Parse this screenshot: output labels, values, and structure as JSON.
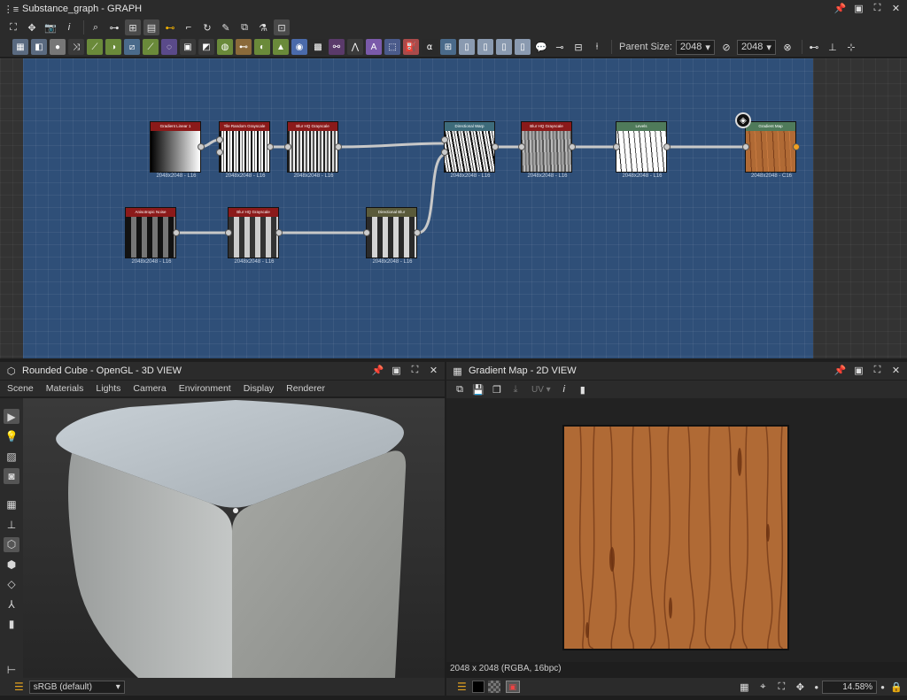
{
  "graph_panel": {
    "title": "Substance_graph - GRAPH"
  },
  "graph_toolbar": {
    "parent_size_label": "Parent Size:",
    "parent_size_value": "2048",
    "size_value": "2048"
  },
  "nodes": [
    {
      "title": "Gradient Linear 1",
      "res": "2048x2048 - L16"
    },
    {
      "title": "Tile Random Grayscale",
      "res": "2048x2048 - L16"
    },
    {
      "title": "Blur HQ Grayscale",
      "res": "2048x2048 - L16"
    },
    {
      "title": "Directional Warp",
      "res": "2048x2048 - L16"
    },
    {
      "title": "Blur HQ Grayscale",
      "res": "2048x2048 - L16"
    },
    {
      "title": "Levels",
      "res": "2048x2048 - L16"
    },
    {
      "title": "Gradient Map",
      "res": "2048x2048 - C16"
    },
    {
      "title": "Anisotropic Noise",
      "res": "2048x2048 - L16"
    },
    {
      "title": "Blur HQ Grayscale",
      "res": "2048x2048 - L16"
    },
    {
      "title": "Directional Blur",
      "res": "2048x2048 - L16"
    }
  ],
  "view3d": {
    "title": "Rounded Cube - OpenGL - 3D VIEW",
    "menu": [
      "Scene",
      "Materials",
      "Lights",
      "Camera",
      "Environment",
      "Display",
      "Renderer"
    ],
    "colorspace": "sRGB (default)"
  },
  "view2d": {
    "title": "Gradient Map - 2D VIEW",
    "uv_label": "UV",
    "info": "2048 x 2048 (RGBA, 16bpc)",
    "zoom": "14.58%"
  },
  "colors": {
    "graph_bg": "#2f4f78",
    "header_red": "#8b1a1a",
    "header_teal": "#3d6b7a",
    "header_green": "#4f7a5a",
    "header_olive": "#5a5a3a",
    "wood": "#b06a35"
  }
}
